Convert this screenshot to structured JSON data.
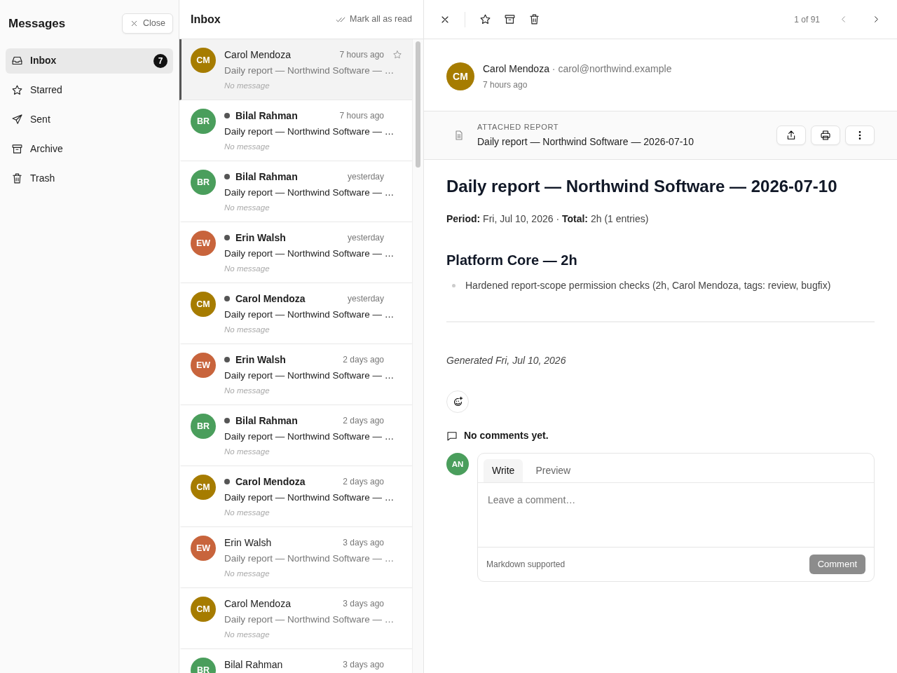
{
  "sidebar": {
    "title": "Messages",
    "close_label": "Close",
    "items": [
      {
        "label": "Inbox",
        "count": "7",
        "selected": true
      },
      {
        "label": "Starred",
        "selected": false
      },
      {
        "label": "Sent",
        "selected": false
      },
      {
        "label": "Archive",
        "selected": false
      },
      {
        "label": "Trash",
        "selected": false
      }
    ]
  },
  "inbox": {
    "title": "Inbox",
    "mark_all_label": "Mark all as read",
    "messages": [
      {
        "initials": "CM",
        "color": "#a67c00",
        "sender": "Carol Mendoza",
        "time": "7 hours ago",
        "subject": "Daily report — Northwind Software — …",
        "preview": "No message",
        "unread": false,
        "selected": true
      },
      {
        "initials": "BR",
        "color": "#4a9e5c",
        "sender": "Bilal Rahman",
        "time": "7 hours ago",
        "subject": "Daily report — Northwind Software — …",
        "preview": "No message",
        "unread": true,
        "selected": false
      },
      {
        "initials": "BR",
        "color": "#4a9e5c",
        "sender": "Bilal Rahman",
        "time": "yesterday",
        "subject": "Daily report — Northwind Software — …",
        "preview": "No message",
        "unread": true,
        "selected": false
      },
      {
        "initials": "EW",
        "color": "#c8643c",
        "sender": "Erin Walsh",
        "time": "yesterday",
        "subject": "Daily report — Northwind Software — …",
        "preview": "No message",
        "unread": true,
        "selected": false
      },
      {
        "initials": "CM",
        "color": "#a67c00",
        "sender": "Carol Mendoza",
        "time": "yesterday",
        "subject": "Daily report — Northwind Software — …",
        "preview": "No message",
        "unread": true,
        "selected": false
      },
      {
        "initials": "EW",
        "color": "#c8643c",
        "sender": "Erin Walsh",
        "time": "2 days ago",
        "subject": "Daily report — Northwind Software — …",
        "preview": "No message",
        "unread": true,
        "selected": false
      },
      {
        "initials": "BR",
        "color": "#4a9e5c",
        "sender": "Bilal Rahman",
        "time": "2 days ago",
        "subject": "Daily report — Northwind Software — …",
        "preview": "No message",
        "unread": true,
        "selected": false
      },
      {
        "initials": "CM",
        "color": "#a67c00",
        "sender": "Carol Mendoza",
        "time": "2 days ago",
        "subject": "Daily report — Northwind Software — …",
        "preview": "No message",
        "unread": true,
        "selected": false
      },
      {
        "initials": "EW",
        "color": "#c8643c",
        "sender": "Erin Walsh",
        "time": "3 days ago",
        "subject": "Daily report — Northwind Software — …",
        "preview": "No message",
        "unread": false,
        "selected": false
      },
      {
        "initials": "CM",
        "color": "#a67c00",
        "sender": "Carol Mendoza",
        "time": "3 days ago",
        "subject": "Daily report — Northwind Software — …",
        "preview": "No message",
        "unread": false,
        "selected": false
      },
      {
        "initials": "BR",
        "color": "#4a9e5c",
        "sender": "Bilal Rahman",
        "time": "3 days ago",
        "unread": false,
        "selected": false
      }
    ]
  },
  "detail": {
    "position": "1 of 91",
    "sender": {
      "initials": "CM",
      "color": "#a67c00",
      "name": "Carol Mendoza",
      "email": "· carol@northwind.example",
      "time": "7 hours ago"
    },
    "attachment": {
      "label": "ATTACHED REPORT",
      "title": "Daily report — Northwind Software — 2026-07-10"
    },
    "heading": "Daily report — Northwind Software — 2026-07-10",
    "summary": "**Period:** Fri, Jul 10, 2026 · **Total:** 2h (1 entries)",
    "section_heading": "Platform Core — 2h",
    "entries": [
      "Hardened report-scope permission checks (2h, Carol Mendoza, tags: review, bugfix)"
    ],
    "generated": "Generated Fri, Jul 10, 2026",
    "comments_status": "No comments yet.",
    "composer": {
      "initials": "AN",
      "color": "#4a9e5c",
      "tabs": [
        {
          "label": "Write",
          "selected": true
        },
        {
          "label": "Preview",
          "selected": false
        }
      ],
      "placeholder": "Leave a comment…",
      "hint": "Markdown supported",
      "submit_label": "Comment"
    }
  }
}
